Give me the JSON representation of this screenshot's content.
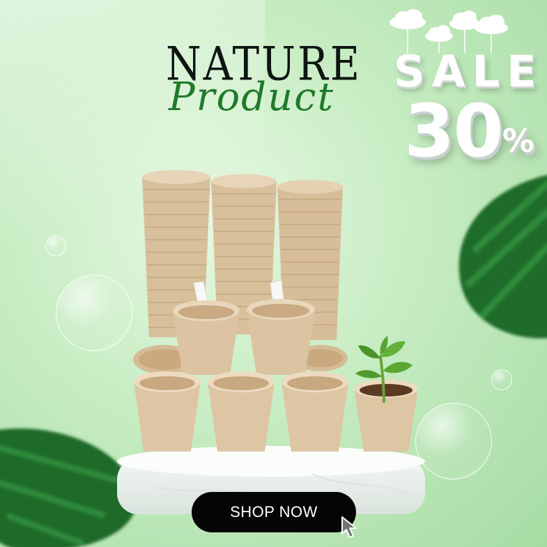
{
  "brand": {
    "title": "NATURE",
    "subtitle": "Product"
  },
  "sale": {
    "word": "SALE",
    "percent": "30",
    "percent_sign": "%"
  },
  "cta": {
    "label": "SHOP NOW"
  },
  "colors": {
    "background": "#c6ecc2",
    "title": "#0e1512",
    "subtitle": "#1f7a2a",
    "pot": "#dcc3a1",
    "button": "#050505"
  },
  "icons": {
    "cursor": "mouse-pointer-icon"
  }
}
